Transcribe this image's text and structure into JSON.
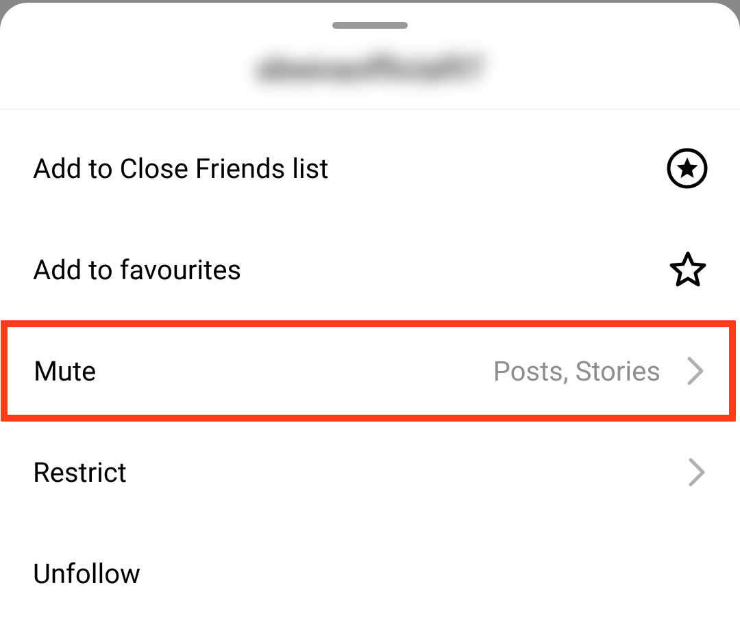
{
  "sheet": {
    "username": "aleenaofficial97",
    "items": {
      "closeFriends": {
        "label": "Add to Close Friends list"
      },
      "favourites": {
        "label": "Add to favourites"
      },
      "mute": {
        "label": "Mute",
        "value": "Posts, Stories"
      },
      "restrict": {
        "label": "Restrict"
      },
      "unfollow": {
        "label": "Unfollow"
      }
    }
  }
}
